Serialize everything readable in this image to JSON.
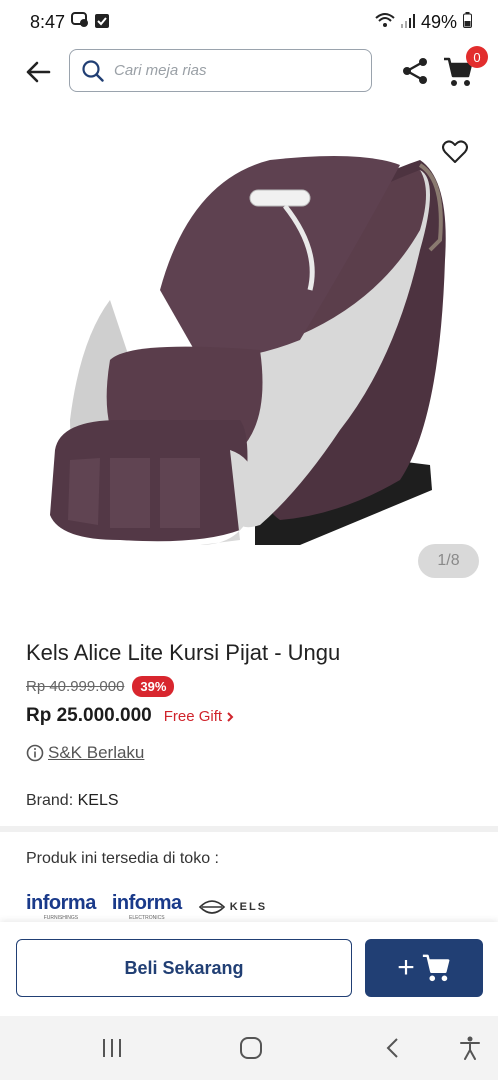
{
  "status_bar": {
    "time": "8:47",
    "battery": "49%"
  },
  "header": {
    "search_placeholder": "Cari meja rias",
    "cart_count": "0"
  },
  "gallery": {
    "counter": "1/8"
  },
  "product": {
    "title": "Kels Alice Lite Kursi Pijat - Ungu",
    "old_price": "Rp 40.999.000",
    "discount": "39%",
    "price": "Rp 25.000.000",
    "free_gift": "Free Gift",
    "terms": "S&K Berlaku",
    "brand_label": "Brand:",
    "brand_value": "KELS"
  },
  "stores": {
    "label": "Produk ini tersedia di toko :",
    "logos": [
      {
        "brand": "informa",
        "sub": "FURNISHINGS"
      },
      {
        "brand": "informa",
        "sub": "ELECTRONICS"
      },
      {
        "brand": "KELS"
      }
    ]
  },
  "actions": {
    "buy_now": "Beli Sekarang",
    "add_to_cart_symbol": "+"
  },
  "colors": {
    "primary": "#213f74",
    "discount": "#d8262e",
    "badge": "#e22d2d"
  }
}
